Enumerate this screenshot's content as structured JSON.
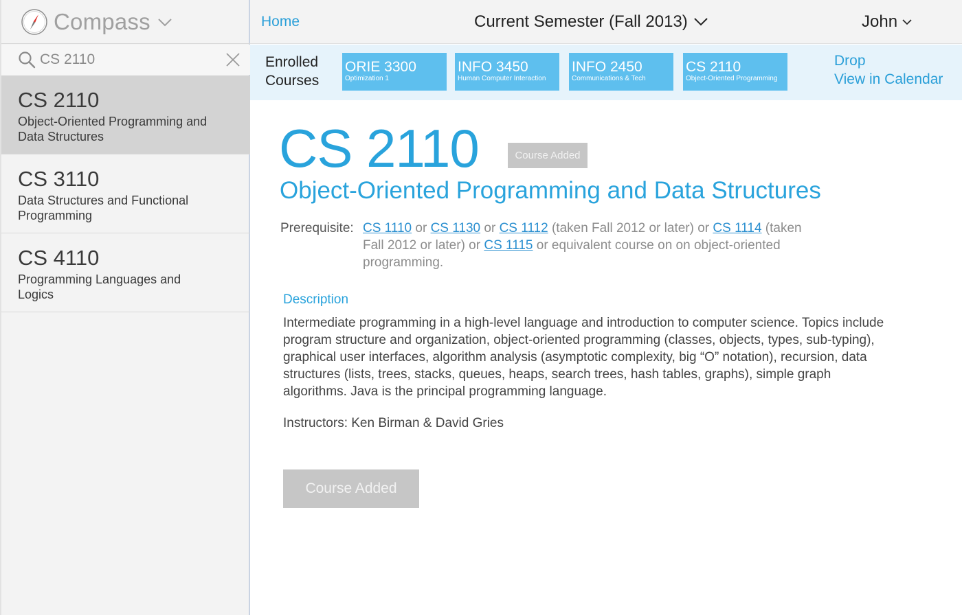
{
  "brand": {
    "name": "Compass",
    "icon": "compass-icon",
    "dropdown_icon": "chevron-down-icon"
  },
  "search": {
    "value": "CS 2110",
    "icon": "search-icon",
    "clear_icon": "close-icon"
  },
  "results": [
    {
      "code": "CS 2110",
      "title": "Object-Oriented Programming and Data Structures",
      "active": true
    },
    {
      "code": "CS 3110",
      "title": "Data Structures and Functional Programming",
      "active": false
    },
    {
      "code": "CS 4110",
      "title": "Programming Languages and Logics",
      "active": false
    }
  ],
  "topbar": {
    "home": "Home",
    "semester": "Current Semester (Fall 2013)",
    "user": "John"
  },
  "enrolled": {
    "label_line1": "Enrolled",
    "label_line2": "Courses",
    "courses": [
      {
        "code": "ORIE 3300",
        "title": "Optimization 1"
      },
      {
        "code": "INFO 3450",
        "title": "Human Computer Interaction"
      },
      {
        "code": "INFO 2450",
        "title": "Communications & Tech"
      },
      {
        "code": "CS 2110",
        "title": "Object-Oriented Programming"
      }
    ],
    "drop": "Drop",
    "calendar": "View in Calendar"
  },
  "course": {
    "code": "CS 2110",
    "badge": "Course Added",
    "title": "Object-Oriented Programming and Data Structures",
    "prereq_label": "Prerequisite:",
    "prereq": {
      "c1": "CS 1110",
      "t1": " or ",
      "c2": "CS 1130",
      "t2": " or ",
      "c3": "CS 1112",
      "t3": " (taken Fall 2012 or later) or ",
      "c4": "CS 1114",
      "t4": " (taken Fall 2012 or later) or ",
      "c5": "CS 1115",
      "t5": " or equivalent course on on object-oriented programming."
    },
    "description_heading": "Description",
    "description": "Intermediate programming in a high-level language and introduction to computer science. Topics include program structure and organization, object-oriented programming (classes, objects, types, sub-typing), graphical user interfaces, algorithm analysis (asymptotic complexity, big “O” notation), recursion, data structures (lists, trees, stacks, queues, heaps, search trees, hash tables, graphs), simple graph algorithms. Java is the principal programming language.",
    "instructors": "Instructors: Ken Birman & David Gries",
    "button": "Course Added"
  },
  "colors": {
    "accent": "#29a3dc",
    "chip": "#5ebfee",
    "disabled": "#c6c6c6"
  }
}
